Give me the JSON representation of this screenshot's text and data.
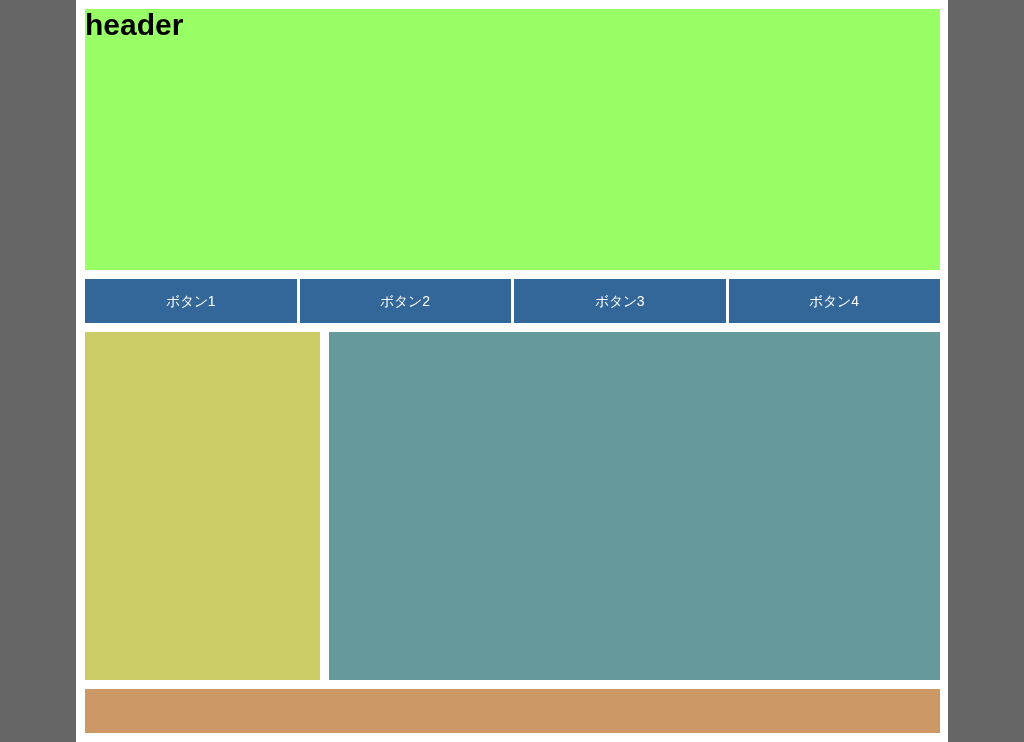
{
  "header": {
    "title": "header"
  },
  "nav": {
    "buttons": [
      {
        "label": "ボタン1"
      },
      {
        "label": "ボタン2"
      },
      {
        "label": "ボタン3"
      },
      {
        "label": "ボタン4"
      }
    ]
  }
}
